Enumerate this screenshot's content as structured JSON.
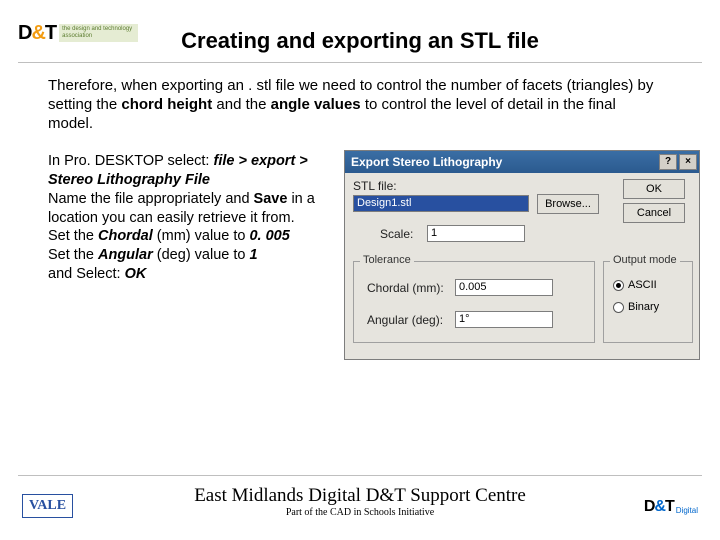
{
  "header": {
    "dt_logo_text": "D&T",
    "dt_logo_caption": "the design and technology association",
    "title": "Creating and exporting an STL file"
  },
  "intro": {
    "pre": "Therefore, when exporting an . stl file we need to control the number of facets (triangles) by setting the ",
    "b1": "chord height",
    "mid": " and the ",
    "b2": "angle values",
    "post": " to control the level of detail in the final model."
  },
  "steps": {
    "l1a": "In Pro. DESKTOP select: ",
    "l1b": "file > export > Stereo Lithography File",
    "l2a": "Name the file appropriately and ",
    "l2b": "Save",
    "l2c": " in a location you can easily retrieve it from.",
    "l3a": "Set the ",
    "l3b": "Chordal",
    "l3c": " (mm) value to ",
    "l3d": "0. 005",
    "l4a": "Set the ",
    "l4b": "Angular",
    "l4c": " (deg) value to ",
    "l4d": "1",
    "l5a": "and Select: ",
    "l5b": "OK"
  },
  "dialog": {
    "title": "Export Stereo Lithography",
    "help_btn": "?",
    "close_btn": "×",
    "stl_label": "STL file:",
    "stl_value": "Design1.stl",
    "browse": "Browse...",
    "ok": "OK",
    "cancel": "Cancel",
    "scale_label": "Scale:",
    "scale_value": "1",
    "tolerance_legend": "Tolerance",
    "chordal_label": "Chordal (mm):",
    "chordal_value": "0.005",
    "angular_label": "Angular (deg):",
    "angular_value": "1°",
    "output_legend": "Output mode",
    "ascii": "ASCII",
    "binary": "Binary"
  },
  "footer": {
    "title": "East Midlands Digital D&T Support Centre",
    "sub": "Part of the CAD in Schools Initiative",
    "vale": "VALE",
    "dt_digital": "D&T",
    "dt_digital_txt": "Digital"
  }
}
